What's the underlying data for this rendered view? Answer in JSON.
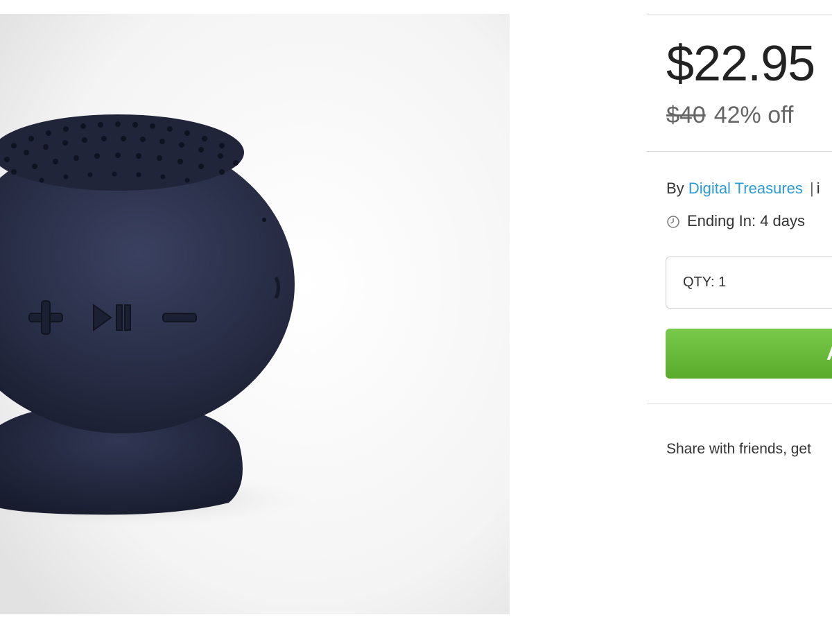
{
  "product": {
    "image_alt": "navy suction-cup bluetooth speaker",
    "body_color": "#2a2f45"
  },
  "pricing": {
    "sale_price": "$22.95",
    "original_price": "$40",
    "discount": "42% off"
  },
  "vendor": {
    "prefix": "By",
    "name": "Digital Treasures",
    "separator": "|",
    "trailing": "i"
  },
  "timing": {
    "ending_text": "Ending In: 4 days",
    "icon": "clock-icon"
  },
  "purchase": {
    "quantity_text": "QTY: 1",
    "add_button_label": "A"
  },
  "share": {
    "text": "Share with friends, get"
  },
  "colors": {
    "link": "#2b9bd6",
    "add_button": "#68b93a",
    "divider": "#d9d9d9"
  }
}
